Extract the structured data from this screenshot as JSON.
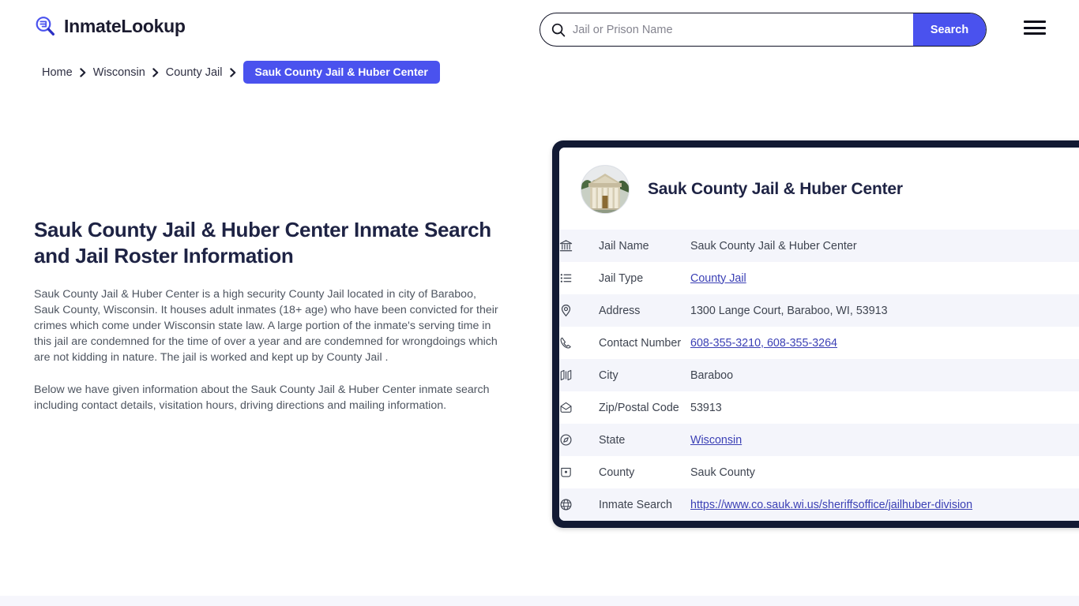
{
  "brand": {
    "name": "InmateLookup",
    "icon": "magnifier-list-icon"
  },
  "search": {
    "placeholder": "Jail or Prison Name",
    "value": "",
    "button_label": "Search",
    "icon": "search-icon"
  },
  "menu": {
    "icon": "hamburger-icon"
  },
  "breadcrumb": {
    "items": [
      {
        "label": "Home"
      },
      {
        "label": "Wisconsin"
      },
      {
        "label": "County Jail"
      }
    ],
    "current": "Sauk County Jail & Huber Center"
  },
  "main": {
    "title": "Sauk County Jail & Huber Center Inmate Search and Jail Roster Information",
    "paragraphs": [
      "Sauk County Jail & Huber Center is a high security County Jail located in city of Baraboo, Sauk County, Wisconsin. It houses adult inmates (18+ age) who have been convicted for their crimes which come under Wisconsin state law. A large portion of the inmate's serving time in this jail are condemned for the time of over a year and are condemned for wrongdoings which are not kidding in nature. The jail is worked and kept up by County Jail .",
      "Below we have given information about the Sauk County Jail & Huber Center inmate search including contact details, visitation hours, driving directions and mailing information."
    ]
  },
  "card": {
    "title": "Sauk County Jail & Huber Center",
    "photo_alt": "sauk-county-courthouse-photo",
    "rows": [
      {
        "icon": "bank-icon",
        "label": "Jail Name",
        "value": "Sauk County Jail & Huber Center",
        "link": false
      },
      {
        "icon": "list-icon",
        "label": "Jail Type",
        "value": "County Jail",
        "link": true
      },
      {
        "icon": "location-pin-icon",
        "label": "Address",
        "value": "1300 Lange Court, Baraboo, WI, 53913",
        "link": false
      },
      {
        "icon": "phone-icon",
        "label": "Contact Number",
        "value": "608-355-3210, 608-355-3264",
        "link": true
      },
      {
        "icon": "map-icon",
        "label": "City",
        "value": "Baraboo",
        "link": false
      },
      {
        "icon": "envelope-icon",
        "label": "Zip/Postal Code",
        "value": "53913",
        "link": false
      },
      {
        "icon": "compass-icon",
        "label": "State",
        "value": "Wisconsin",
        "link": true
      },
      {
        "icon": "county-map-icon",
        "label": "County",
        "value": "Sauk County",
        "link": false
      },
      {
        "icon": "globe-icon",
        "label": "Inmate Search",
        "value": "https://www.co.sauk.wi.us/sheriffsoffice/jailhuber-division",
        "link": true
      }
    ]
  },
  "colors": {
    "accent": "#4a52ee",
    "card_border": "#121a33",
    "row_alt": "#f4f5fb",
    "link": "#3b40b5",
    "heading": "#1e2344",
    "body_text": "#4e5560"
  }
}
